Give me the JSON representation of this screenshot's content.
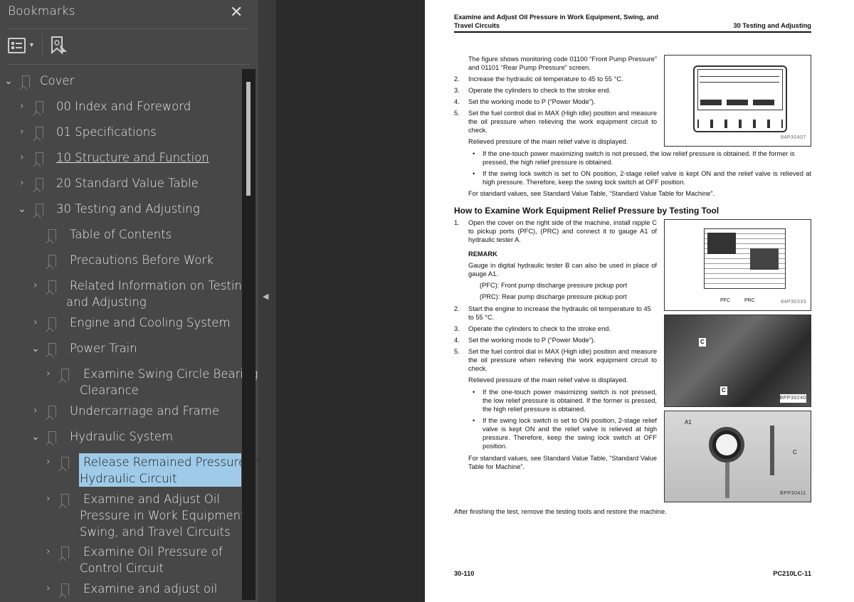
{
  "sidebar": {
    "title": "Bookmarks",
    "close_icon": "close-icon",
    "toolbar": {
      "options_icon": "list-options-icon",
      "find_icon": "bookmark-find-icon"
    },
    "items": [
      {
        "label": "Cover",
        "state": "expanded"
      },
      {
        "label": "00 Index and Foreword",
        "state": "collapsed"
      },
      {
        "label": "01 Specifications",
        "state": "collapsed"
      },
      {
        "label": "10 Structure and Function",
        "state": "collapsed"
      },
      {
        "label": "20 Standard Value Table",
        "state": "collapsed"
      },
      {
        "label": "30 Testing and Adjusting",
        "state": "expanded"
      },
      {
        "label": "Table of Contents",
        "state": "leaf"
      },
      {
        "label": "Precautions Before Work",
        "state": "leaf"
      },
      {
        "label1": "Related Information on Testing",
        "label2": "and Adjusting",
        "state": "collapsed"
      },
      {
        "label": "Engine and Cooling System",
        "state": "collapsed"
      },
      {
        "label": "Power Train",
        "state": "expanded"
      },
      {
        "label1": "Examine Swing Circle Bearing",
        "label2": "Clearance",
        "state": "collapsed"
      },
      {
        "label": "Undercarriage and Frame",
        "state": "collapsed"
      },
      {
        "label": "Hydraulic System",
        "state": "expanded"
      },
      {
        "label1": "Release Remained Pressure in",
        "label2": "Hydraulic Circuit",
        "state": "collapsed",
        "selected": true
      },
      {
        "label1": "Examine and Adjust Oil",
        "label2": "Pressure in Work Equipment,",
        "label3": "Swing, and Travel Circuits",
        "state": "collapsed"
      },
      {
        "label1": "Examine Oil Pressure of",
        "label2": "Control Circuit",
        "state": "collapsed"
      },
      {
        "label": "Examine and adjust oil",
        "state": "collapsed"
      }
    ],
    "selected_color": "#9fcbe8"
  },
  "page": {
    "header_title1": "Examine and Adjust Oil Pressure in Work Equipment, Swing, and",
    "header_title2": "Travel Circuits",
    "header_section": "30 Testing and Adjusting",
    "s1": {
      "intro": "The figure shows monitoring code 01100 “Front Pump Pressure” and 01101 “Rear Pump Pressure” screen.",
      "steps": [
        {
          "n": "2.",
          "t": "Increase the hydraulic oil temperature to 45 to 55 °C."
        },
        {
          "n": "3.",
          "t": "Operate the cylinders to check to the stroke end."
        },
        {
          "n": "4.",
          "t": "Set the working mode to P (“Power Mode”)."
        },
        {
          "n": "5.",
          "t": "Set the fuel control dial in MAX (High idle) position and measure the oil pressure when relieving the work equipment circuit to check."
        }
      ],
      "relieved": "Relieved pressure of the main relief valve is displayed.",
      "bullet1": "If the one-touch power maximizing switch is not pressed, the low relief pressure is obtained. If the former is pressed, the high relief pressure is obtained.",
      "bullet2": "If the swing lock switch is set to ON position, 2-stage relief valve is kept ON and the relief valve is relieved at high pressure. Therefore, keep the swing lock switch at OFF position.",
      "standard": "For standard values, see Standard Value Table, “Standard Value Table for Machine”.",
      "fig_caption": "84P30407"
    },
    "s2": {
      "heading": "How to Examine Work Equipment Relief Pressure by Testing Tool",
      "step1": {
        "n": "1.",
        "t": "Open the cover on the right side of the machine, install nipple C to pickup ports (PFC), (PRC) and connect it to gauge A1 of hydraulic tester A."
      },
      "remark": "REMARK",
      "remark_text": "Gauge in digital hydraulic tester B can also be used in place of gauge A1.",
      "pfc": "(PFC): Front pump discharge pressure pickup port",
      "prc": "(PRC): Rear pump discharge pressure pickup port",
      "steps": [
        {
          "n": "2.",
          "t": "Start the engine to increase the hydraulic oil temperature to 45 to 55 °C."
        },
        {
          "n": "3.",
          "t": "Operate the cylinders to check to the stroke end."
        },
        {
          "n": "4.",
          "t": "Set the working mode to P (“Power Mode”)."
        },
        {
          "n": "5.",
          "t": "Set the fuel control dial in MAX (High idle) position and measure the oil pressure when relieving the work equipment circuit to check."
        }
      ],
      "relieved": "Relieved pressure of the main relief valve is displayed.",
      "bullet1": "If the one-touch power maximizing switch is not pressed, the low relief pressure is obtained. If the former is pressed, the high relief pressure is obtained.",
      "bullet2": "If the swing lock switch is set to ON position, 2-stage relief valve is kept ON and the relief valve is relieved at high pressure. Therefore, keep the swing lock switch at OFF position.",
      "standard": "For standard values, see Standard Value Table, “Standard Value Table for Machine”.",
      "fig2": {
        "caption": "84P30333",
        "label_pfc": "PFC",
        "label_prc": "PRC"
      },
      "fig3": {
        "caption": "BPP30240",
        "label_c": "C"
      },
      "fig4": {
        "caption": "BPP30411",
        "label_a1": "A1",
        "label_c": "C"
      }
    },
    "after": "After finishing the test, remove the testing tools and restore the machine.",
    "footer_page": "30-110",
    "footer_model": "PC210LC-11"
  }
}
